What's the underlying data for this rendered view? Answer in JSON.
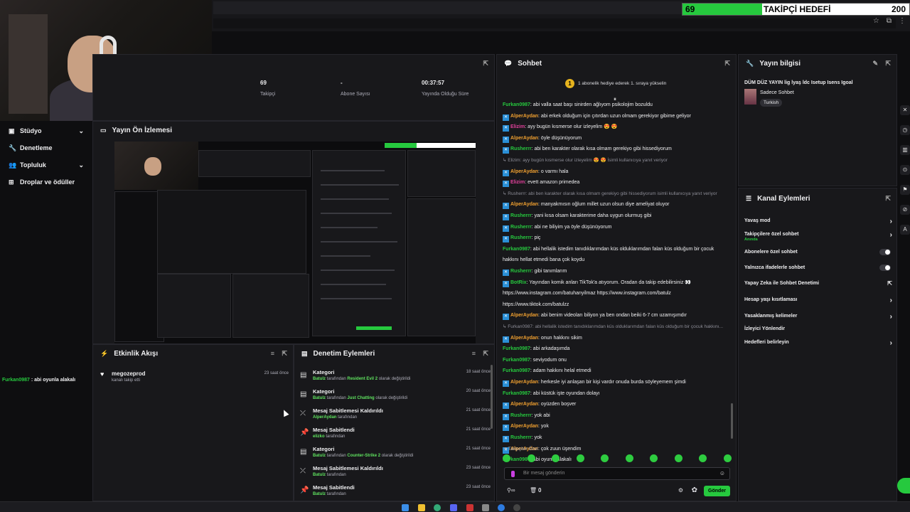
{
  "goal": {
    "current": "69",
    "label": "TAKİPÇİ HEDEFİ",
    "target": "200"
  },
  "sidebar": {
    "items": [
      {
        "label": "Stüdyo",
        "icon": "video-icon",
        "has_chevron": true
      },
      {
        "label": "Denetleme",
        "icon": "wrench-icon",
        "has_chevron": false
      },
      {
        "label": "Topluluk",
        "icon": "people-icon",
        "has_chevron": true
      },
      {
        "label": "Droplar ve ödüller",
        "icon": "gift-icon",
        "has_chevron": false
      }
    ]
  },
  "stats": [
    {
      "value": "69",
      "label": "Takipçi"
    },
    {
      "value": "-",
      "label": "Abone Sayısı"
    },
    {
      "value": "00:37:57",
      "label": "Yayında Olduğu Süre"
    }
  ],
  "preview": {
    "title": "Yayın Ön İzlemesi"
  },
  "activity": {
    "title": "Etkinlik Akışı",
    "items": [
      {
        "name": "megozeprod",
        "sub": "kanalı takip etti",
        "time": "23 saat önce"
      }
    ]
  },
  "modlog": {
    "title": "Denetim Eylemleri",
    "rows": [
      {
        "title": "Kategori",
        "actor": "Batulz",
        "mid": " tarafından ",
        "value": "Resident Evil 2",
        "suffix": " olarak değiştirildi",
        "time": "18 saat önce",
        "icon": "category-icon"
      },
      {
        "title": "Kategori",
        "actor": "Batulz",
        "mid": " tarafından ",
        "value": "Just Chatting",
        "suffix": " olarak değiştirildi",
        "time": "20 saat önce",
        "icon": "category-icon"
      },
      {
        "title": "Mesaj Sabitlemesi Kaldırıldı",
        "actor": "AlperAydan",
        "mid": " tarafından",
        "value": "",
        "suffix": "",
        "time": "21 saat önce",
        "icon": "unpin-icon"
      },
      {
        "title": "Mesaj Sabitlendi",
        "actor": "elizko",
        "mid": " tarafından",
        "value": "",
        "suffix": "",
        "time": "21 saat önce",
        "icon": "pin-icon"
      },
      {
        "title": "Kategori",
        "actor": "Batulz",
        "mid": " tarafından ",
        "value": "Counter-Strike 2",
        "suffix": " olarak değiştirildi",
        "time": "21 saat önce",
        "icon": "category-icon"
      },
      {
        "title": "Mesaj Sabitlemesi Kaldırıldı",
        "actor": "Batulz",
        "mid": " tarafından",
        "value": "",
        "suffix": "",
        "time": "23 saat önce",
        "icon": "unpin-icon"
      },
      {
        "title": "Mesaj Sabitlendi",
        "actor": "Batulz",
        "mid": " tarafından",
        "value": "",
        "suffix": "",
        "time": "23 saat önce",
        "icon": "pin-icon"
      }
    ]
  },
  "chat": {
    "title": "Sohbet",
    "pinned": "1 abonelik hediye ederek 1. sıraya yükselin",
    "pinned_rank": "1",
    "messages": [
      {
        "user": "Furkan0987",
        "color": "#26c93e",
        "text": ": abi valla saat başı sinirden ağlıyom psikolojim bozuldu",
        "badge": false,
        "sys": false
      },
      {
        "user": "AlperAydan",
        "color": "#f0a030",
        "text": ": abi erkek olduğum için çıtırdan uzun olmam gerekiyor gibime geliyor",
        "badge": true,
        "sys": false
      },
      {
        "user": "Elizim",
        "color": "#e0409a",
        "text": ": ayy bugün kısmerse olur izleyelim 😍 😍",
        "badge": true,
        "sys": false
      },
      {
        "user": "AlperAydan",
        "color": "#f0a030",
        "text": ": öyle düşünüyorum",
        "badge": true,
        "sys": false
      },
      {
        "user": "Rusherrr",
        "color": "#26c93e",
        "text": ": abi ben karakter olarak kısa olmam gerekiyo gibi hissediyorum",
        "badge": true,
        "sys": false
      },
      {
        "user": "",
        "color": "#8c8c96",
        "text": "↳ Elizim: ayy bugün kısmerse olur izleyelim 😍 😍 İsimli kullanıcıya yanıt veriyor",
        "badge": false,
        "sys": true
      },
      {
        "user": "AlperAydan",
        "color": "#f0a030",
        "text": ": o varmı hala",
        "badge": true,
        "sys": false
      },
      {
        "user": "Elizim",
        "color": "#e0409a",
        "text": ": evett amazon primedea",
        "badge": true,
        "sys": false
      },
      {
        "user": "",
        "color": "#8c8c96",
        "text": "↳ Rusherrr: abi ben karakter olarak kısa olmam gerekiyo gibi hissediyorum isimli kullanıcıya yanıt veriyor",
        "badge": false,
        "sys": true
      },
      {
        "user": "AlperAydan",
        "color": "#f0a030",
        "text": ": manyakmısın oğlum millet uzun olsun diye ameliyat oluyor",
        "badge": true,
        "sys": false
      },
      {
        "user": "Rusherrr",
        "color": "#26c93e",
        "text": ": yani kısa olsam karakterime daha uygun olurmuş gibi",
        "badge": true,
        "sys": false
      },
      {
        "user": "Rusherrr",
        "color": "#26c93e",
        "text": ": abi ne biliyim ya öyle düşünüyorum",
        "badge": true,
        "sys": false
      },
      {
        "user": "Rusherrr",
        "color": "#26c93e",
        "text": ": piç",
        "badge": true,
        "sys": false
      },
      {
        "user": "Furkan0987",
        "color": "#26c93e",
        "text": ": abi hellalik istedim tanıdıklarımdan küs olduklarımdan falan küs olduğum bir çocuk",
        "badge": false,
        "sys": false
      },
      {
        "user": "",
        "color": "#efeff1",
        "text": "hakkını hellat etmedi bana çok koydu",
        "badge": false,
        "sys": false
      },
      {
        "user": "Rusherrr",
        "color": "#26c93e",
        "text": ": gibi tanımlarım",
        "badge": true,
        "sys": false
      },
      {
        "user": "BotRix",
        "color": "#26c93e",
        "text": ": Yayından komik anları TikTok'a atıyorum. Oradan da takip edebilirsiniz 👀",
        "badge": true,
        "sys": false
      },
      {
        "user": "",
        "color": "#efeff1",
        "text": "https://www.instagram.com/batuhanyilmaz https://www.instagram.com/batulz",
        "badge": false,
        "sys": false
      },
      {
        "user": "",
        "color": "#efeff1",
        "text": "https://www.tiktok.com/batulzz",
        "badge": false,
        "sys": false
      },
      {
        "user": "AlperAydan",
        "color": "#f0a030",
        "text": ": abi benim videoları biliyon ya ben ondan beiki 6-7 cm uzamışımdır",
        "badge": true,
        "sys": false
      },
      {
        "user": "",
        "color": "#8c8c96",
        "text": "↳ Furkan0987: abi hellalik istedim tanıdıklarımdan küs olduklarımdan falan küs olduğum bir çocuk hakkını...",
        "badge": false,
        "sys": true
      },
      {
        "user": "AlperAydan",
        "color": "#f0a030",
        "text": ": onun hakkını sikim",
        "badge": true,
        "sys": false
      },
      {
        "user": "Furkan0987",
        "color": "#26c93e",
        "text": ": abi arkadaşımda",
        "badge": false,
        "sys": false
      },
      {
        "user": "Furkan0987",
        "color": "#26c93e",
        "text": ": seviyodum onu",
        "badge": false,
        "sys": false
      },
      {
        "user": "Furkan0987",
        "color": "#26c93e",
        "text": ": adam hakkını helal etmedi",
        "badge": false,
        "sys": false
      },
      {
        "user": "AlperAydan",
        "color": "#f0a030",
        "text": ": herkesle iyi anlaşan bir kişi vardır onuda burda söyleyemem şimdi",
        "badge": true,
        "sys": false
      },
      {
        "user": "Furkan0987",
        "color": "#26c93e",
        "text": ": abi küstük işte oyundan dolayı",
        "badge": false,
        "sys": false
      },
      {
        "user": "AlperAydan",
        "color": "#f0a030",
        "text": ": oyüzden boşver",
        "badge": true,
        "sys": false
      },
      {
        "user": "Rusherrr",
        "color": "#26c93e",
        "text": ": yok abi",
        "badge": true,
        "sys": false
      },
      {
        "user": "AlperAydan",
        "color": "#f0a030",
        "text": ": yok",
        "badge": true,
        "sys": false
      },
      {
        "user": "Rusherrr",
        "color": "#26c93e",
        "text": ": yok",
        "badge": true,
        "sys": false
      },
      {
        "user": "AlperAydan",
        "color": "#f0a030",
        "text": ": çok zuun üşendim",
        "badge": true,
        "sys": false
      },
      {
        "user": "Furkan0987",
        "color": "#26c93e",
        "text": ": abi oyunla alakalı",
        "badge": false,
        "sys": false
      }
    ],
    "followers_only": "Takipçiler Özel",
    "input_placeholder": "Bir mesaj gönderin",
    "count": "0",
    "send_label": "Gönder"
  },
  "streaminfo": {
    "title": "Yayın bilgisi",
    "stream_title": "DÜM DÜZ YAYIN lig lyaş ldc Isetup Isens Igoal",
    "category": "Sadece Sohbet",
    "tag": "Turkish"
  },
  "channel_actions": {
    "title": "Kanal Eylemleri",
    "rows": [
      {
        "label": "Yavaş mod",
        "sub": "",
        "control": "chevron"
      },
      {
        "label": "Takipçilere özel sohbet",
        "sub": "Anında",
        "control": "chevron"
      },
      {
        "label": "Abonelere özel sohbet",
        "sub": "",
        "control": "toggle"
      },
      {
        "label": "Yalnızca ifadelerle sohbet",
        "sub": "",
        "control": "toggle"
      },
      {
        "label": "Yapay Zeka ile Sohbet Denetimi",
        "sub": "",
        "control": "external"
      },
      {
        "label": "Hesap yaşı kısıtlaması",
        "sub": "",
        "control": "chevron"
      },
      {
        "label": "Yasaklanmış kelimeler",
        "sub": "",
        "control": "chevron"
      },
      {
        "label": "İzleyici Yönlendir",
        "sub": "",
        "control": "none"
      },
      {
        "label": "Hedefleri belirleyin",
        "sub": "",
        "control": "chevron"
      }
    ]
  },
  "overlay_chat": {
    "user": "Furkan0987",
    "text": " : abi oyunla alakalı"
  },
  "colors": {
    "accent": "#26c93e",
    "bg": "#0e0e10",
    "panel": "#18181b"
  }
}
